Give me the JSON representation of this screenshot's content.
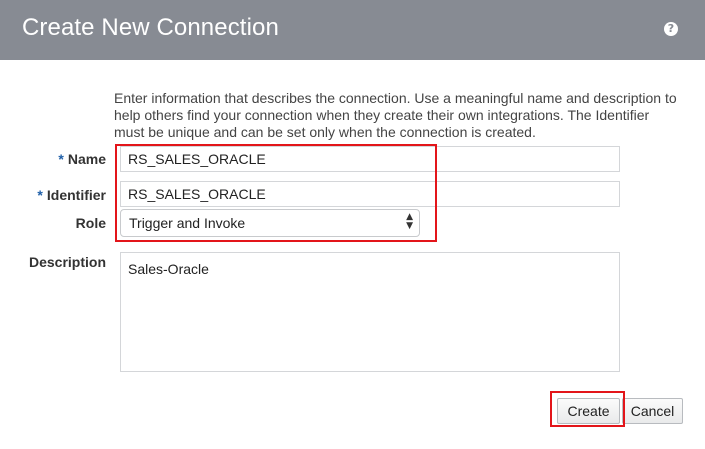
{
  "dialog": {
    "title": "Create New Connection",
    "help_icon": "help-icon",
    "help_glyph": "?"
  },
  "intro_text": "Enter information that describes the connection. Use a meaningful name and description to help others find your connection when they create their own integrations. The Identifier must be unique and can be set only when the connection is created.",
  "form": {
    "required_marker": "*",
    "name": {
      "label": "Name",
      "value": "RS_SALES_ORACLE",
      "required": true
    },
    "identifier": {
      "label": "Identifier",
      "value": "RS_SALES_ORACLE",
      "required": true
    },
    "role": {
      "label": "Role",
      "selected": "Trigger and Invoke"
    },
    "description": {
      "label": "Description",
      "value": "Sales-Oracle"
    }
  },
  "buttons": {
    "create": "Create",
    "cancel": "Cancel"
  },
  "colors": {
    "header": "#878b93",
    "required_marker": "#1f5fa8",
    "highlight": "#e3151a"
  }
}
